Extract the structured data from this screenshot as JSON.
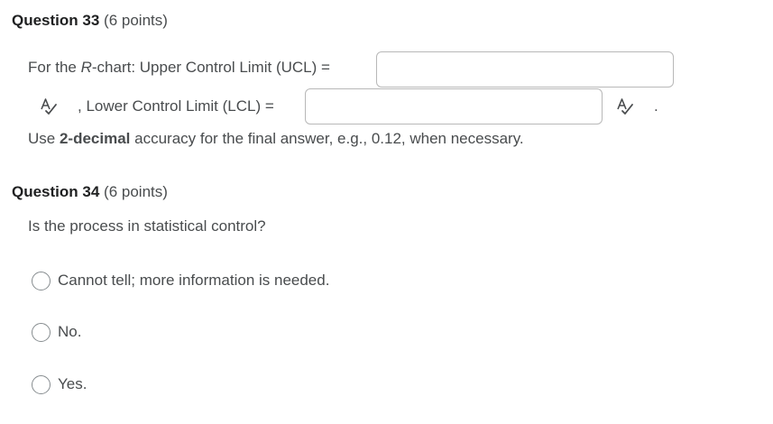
{
  "question33": {
    "title": "Question 33",
    "points": "(6 points)",
    "prefix": "For the ",
    "r_letter": "R",
    "ucl_text": "-chart: Upper Control Limit (UCL) =",
    "ucl_value": "",
    "lcl_text": ", Lower Control Limit (LCL) =",
    "lcl_value": "",
    "period": ".",
    "instruction_pre": "Use ",
    "instruction_bold": "2-decimal",
    "instruction_post": " accuracy for the final answer, e.g., 0.12, when necessary.",
    "spellcheck_icon": "spellcheck-icon"
  },
  "question34": {
    "title": "Question 34",
    "points": "(6 points)",
    "prompt": "Is the process in statistical control?",
    "options": [
      {
        "label": "Cannot tell; more information is needed."
      },
      {
        "label": "No."
      },
      {
        "label": "Yes."
      }
    ]
  },
  "colors": {
    "heading": "#202122",
    "body_text": "#494c4e",
    "input_border": "#b8b8b8",
    "radio_border": "#868c8f"
  }
}
